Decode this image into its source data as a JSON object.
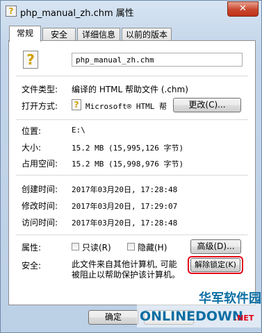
{
  "window": {
    "title": "php_manual_zh.chm 属性",
    "close_label": "✕"
  },
  "tabs": [
    {
      "label": "常规",
      "active": true
    },
    {
      "label": "安全",
      "active": false
    },
    {
      "label": "详细信息",
      "active": false
    },
    {
      "label": "以前的版本",
      "active": false
    }
  ],
  "general": {
    "filename": "php_manual_zh.chm",
    "file_type_label": "文件类型:",
    "file_type_value": "编译的 HTML 帮助文件 (.chm)",
    "open_with_label": "打开方式:",
    "open_with_value": "Microsoft® HTML 帮",
    "change_button": "更改(C)...",
    "location_label": "位置:",
    "location_value": "E:\\",
    "size_label": "大小:",
    "size_value": "15.2 MB (15,995,126 字节)",
    "size_on_disk_label": "占用空间:",
    "size_on_disk_value": "15.2 MB (15,998,976 字节)",
    "created_label": "创建时间:",
    "created_value": "2017年03月20日, 17:28:48",
    "modified_label": "修改时间:",
    "modified_value": "2017年03月20日, 17:29:07",
    "accessed_label": "访问时间:",
    "accessed_value": "2017年03月20日, 17:28:48",
    "attributes_label": "属性:",
    "readonly_label": "只读(R)",
    "hidden_label": "隐藏(H)",
    "advanced_button": "高级(D)...",
    "security_label": "安全:",
    "security_text_1": "此文件来自其他计算机, 可能",
    "security_text_2": "被阻止以帮助保护该计算机。",
    "unlock_button": "解除锁定(K)"
  },
  "footer": {
    "ok_button": "确定"
  },
  "watermark": {
    "top": "华军软件园",
    "logo": "ONLINEDOWN",
    "net": ".NET"
  },
  "colors": {
    "highlight": "#e2001a",
    "watermark": "#0a6ea3"
  }
}
